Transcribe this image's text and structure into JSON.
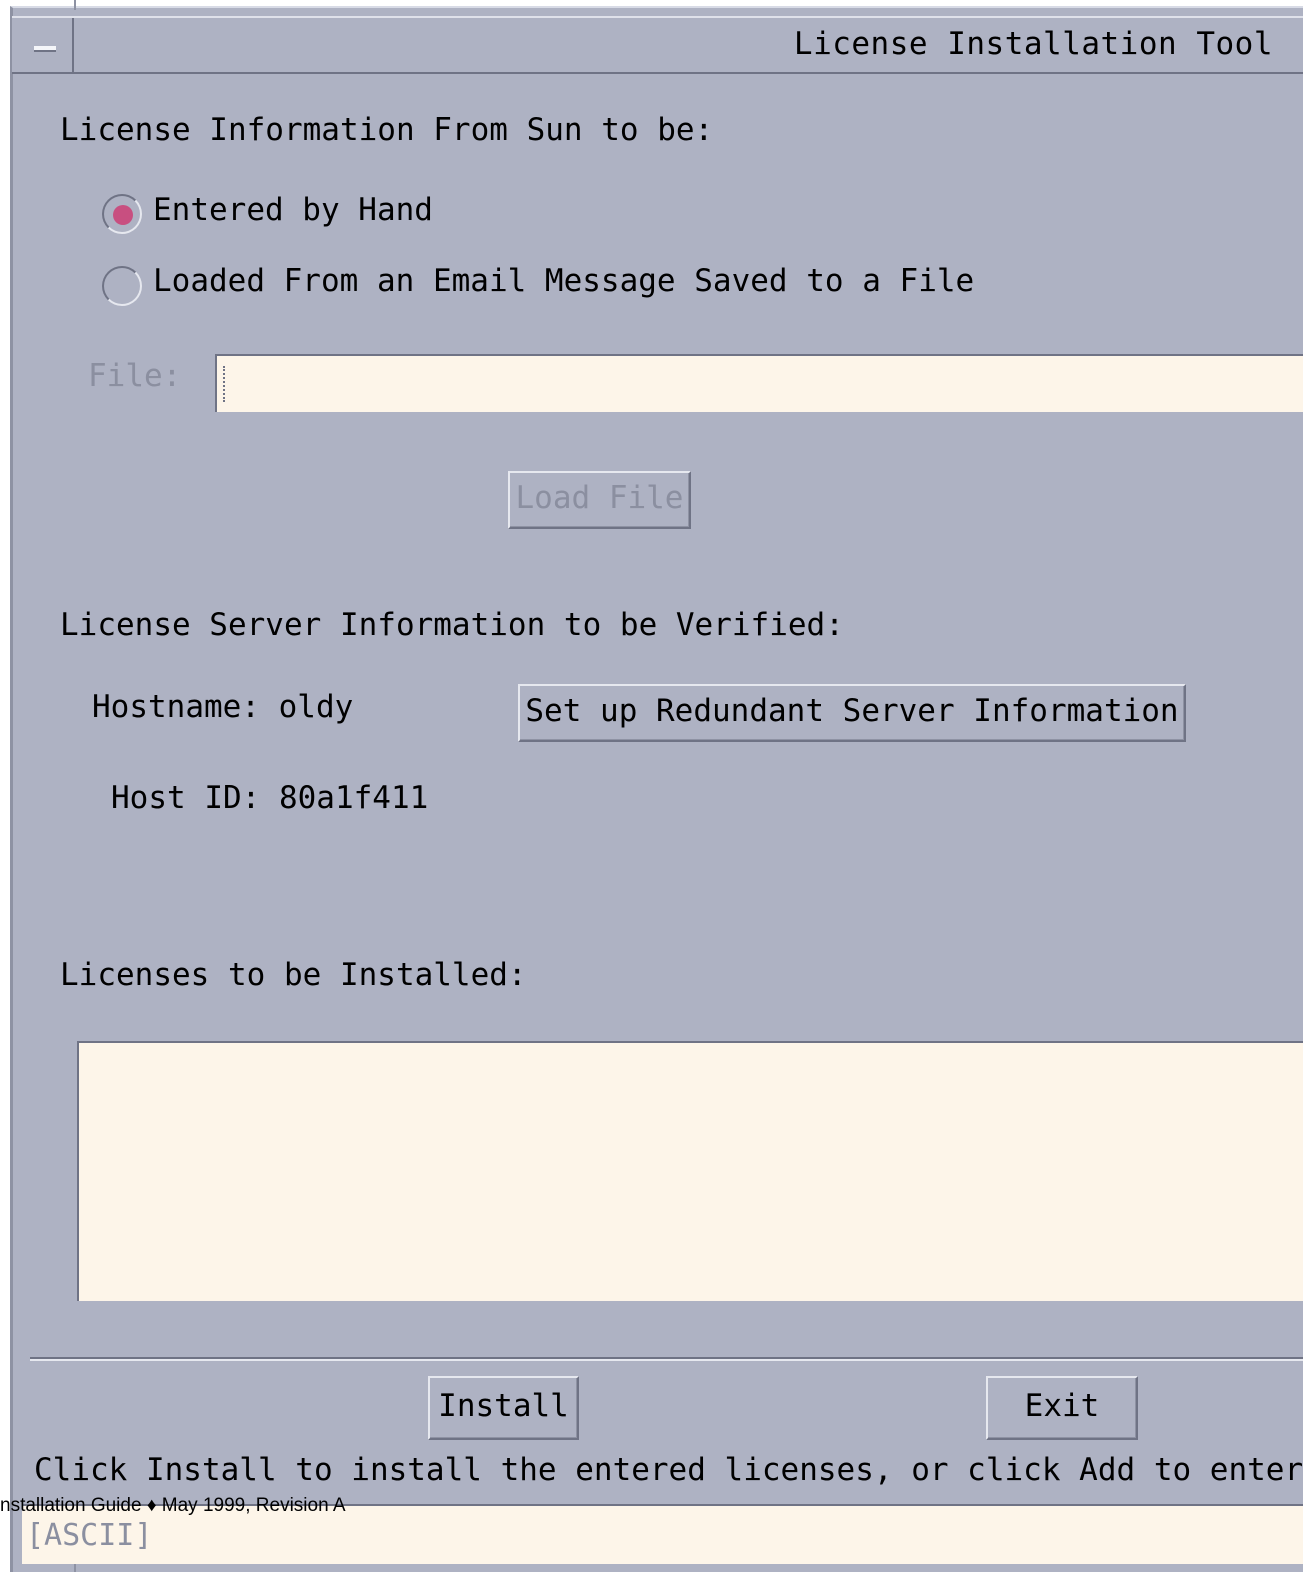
{
  "window": {
    "title": "License Installation Tool"
  },
  "license_info": {
    "heading": "License Information From Sun to be:",
    "options": [
      {
        "label": "Entered by Hand",
        "selected": true
      },
      {
        "label": "Loaded From an Email Message Saved to a File",
        "selected": false
      }
    ],
    "file_label": "File:",
    "file_value": "",
    "load_button": "Load File"
  },
  "server_info": {
    "heading": "License Server Information to be Verified:",
    "hostname": "Hostname: oldy",
    "redundant_button": "Set up Redundant Server Information",
    "host_id": "Host ID: 80a1f411"
  },
  "licenses": {
    "heading": "Licenses to be Installed:",
    "items": []
  },
  "actions": {
    "install": "Install",
    "exit": "Exit"
  },
  "status": {
    "message": "Click Install to install the entered licenses, or click Add to enter",
    "input_mode": "[ASCII]"
  },
  "page_footer": "nstallation Guide ♦ May 1999, Revision A",
  "colors": {
    "background": "#aeb2c3",
    "field": "#fdf5e9",
    "radio_selected": "#c84f80"
  }
}
